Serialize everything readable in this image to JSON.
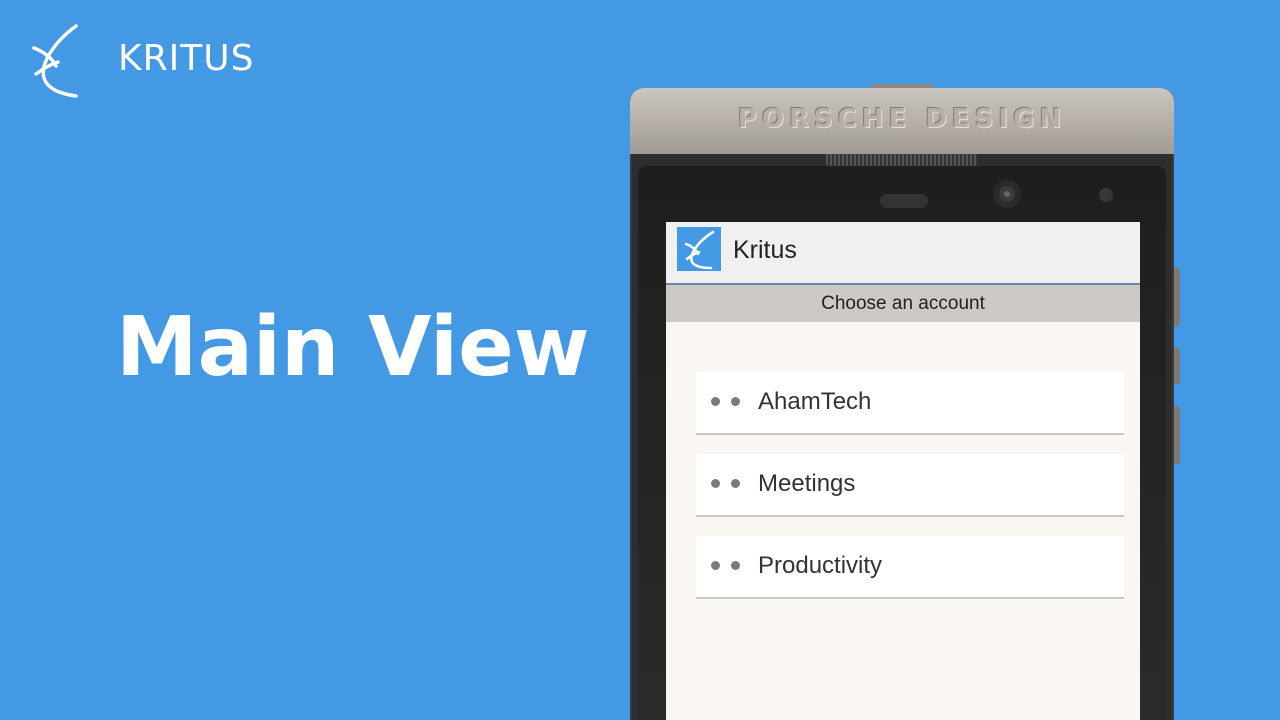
{
  "brand": {
    "logo_icon": "kritus-x-logo-icon",
    "name": "KRITUS"
  },
  "hero": {
    "title": "Main View"
  },
  "phone": {
    "brand_text": "PORSCHE DESIGN"
  },
  "app": {
    "icon": "kritus-app-icon",
    "title": "Kritus",
    "subheader": "Choose  an account",
    "accounts": [
      {
        "label": "AhamTech",
        "icon": "drag-handle-dots-icon"
      },
      {
        "label": "Meetings",
        "icon": "drag-handle-dots-icon"
      },
      {
        "label": "Productivity",
        "icon": "drag-handle-dots-icon"
      }
    ]
  },
  "colors": {
    "background": "#4499e5",
    "app_bar": "#f0f0f0",
    "app_bar_border": "#5f87b8",
    "subheader": "#cdc9c5",
    "screen": "#faf6f2"
  }
}
